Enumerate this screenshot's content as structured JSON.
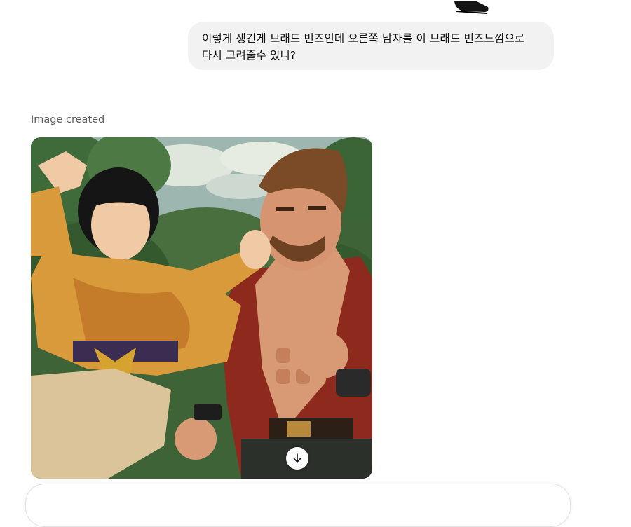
{
  "conversation": {
    "user_message": "이렇게 생긴게 브래드 번즈인데 오른쪽 남자를 이 브래드 번즈느낌으로 다시 그려줄수 있니?",
    "assistant": {
      "status_label": "Image created",
      "image_icon": "generated-illustration",
      "download_icon": "arrow-down-icon"
    }
  },
  "composer": {
    "placeholder": ""
  },
  "colors": {
    "bubble_bg": "#f2f2f2",
    "label_gray": "#5d5d5d",
    "composer_border": "#e3e3e3"
  }
}
